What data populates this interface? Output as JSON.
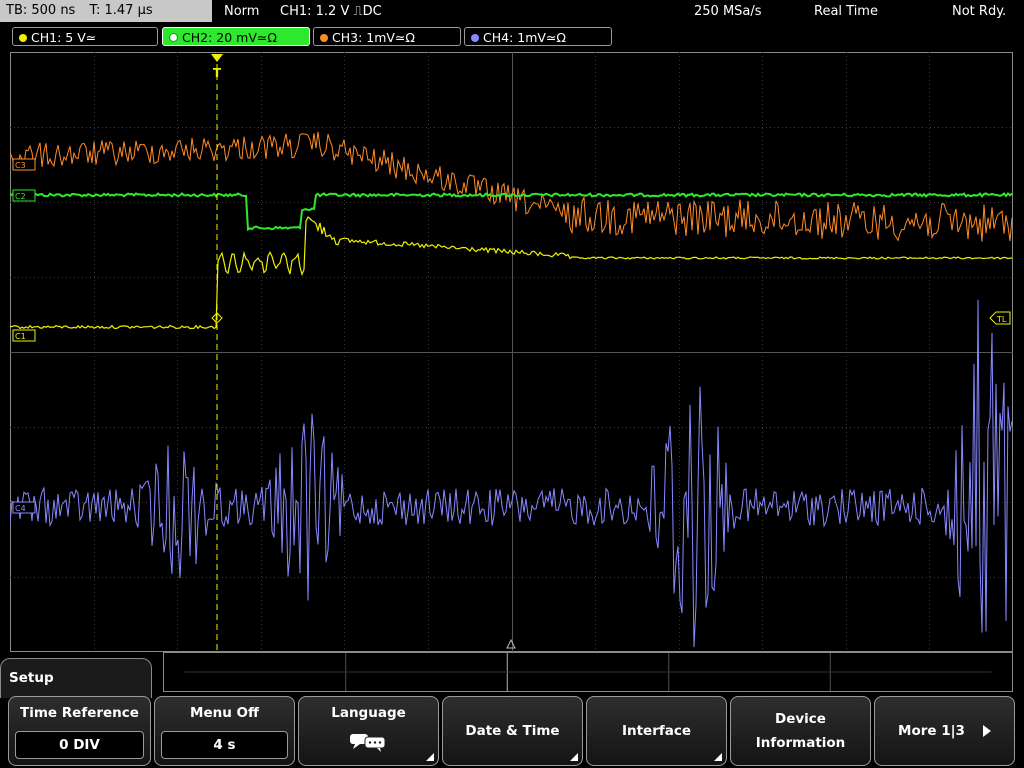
{
  "status_bar": {
    "timebase": "TB: 500 ns",
    "trigger_time": "T: 1.47 µs",
    "mode": "Norm",
    "trigger_setting": "CH1: 1.2 V ⎍DC",
    "sample_rate": "250 MSa/s",
    "acq_mode": "Real Time",
    "run_state": "Not Rdy."
  },
  "channels": [
    {
      "label": "CH1: 5 V≃",
      "color": "#f0f000",
      "active": false
    },
    {
      "label": "CH2: 20 mV≃Ω",
      "color": "#2ee82e",
      "active": true
    },
    {
      "label": "CH3: 1mV≃Ω",
      "color": "#ff8c28",
      "active": false
    },
    {
      "label": "CH4: 1mV≃Ω",
      "color": "#8888ff",
      "active": false
    }
  ],
  "markers": {
    "c3": "C3",
    "c2": "C2",
    "c1": "C1",
    "c4": "C4",
    "tl": "TL"
  },
  "menu": {
    "setup_title": "Setup",
    "time_reference": {
      "label": "Time Reference",
      "value": "0 DIV"
    },
    "menu_off": {
      "label": "Menu Off",
      "value": "4 s"
    },
    "language": {
      "label": "Language"
    },
    "date_time": {
      "label": "Date & Time"
    },
    "interface": {
      "label": "Interface"
    },
    "device_info": {
      "label1": "Device",
      "label2": "Information"
    },
    "more": {
      "label": "More 1|3"
    }
  },
  "icons": [
    "trigger-position-icon",
    "trigger-level-icon",
    "speech-bubble-icon",
    "arrow-right-icon"
  ]
}
